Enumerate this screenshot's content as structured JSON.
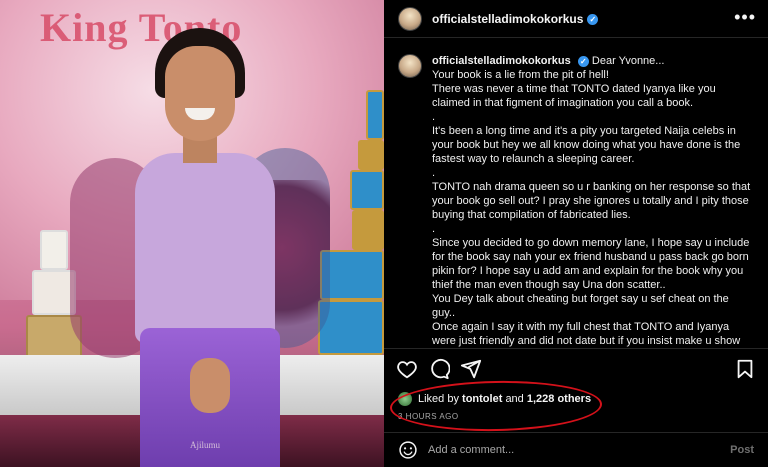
{
  "photo": {
    "banner_text": "King Tonto",
    "watermark": "Ajilumu"
  },
  "post": {
    "author": "officialstelladimokokorkus",
    "verified": true,
    "caption": {
      "author": "officialstelladimokokorkus",
      "verified_mark": "✓",
      "lines": [
        "Dear Yvonne...",
        "Your book is a lie from the pit of hell!",
        "There was never a time that TONTO dated Iyanya like you claimed in that figment of imagination you call a book.",
        ".",
        "It's been a long time and it's a pity you targeted Naija celebs in your book but hey we all know doing what you have done is the fastest way to relaunch a sleeping career.",
        ".",
        "TONTO nah drama queen so u r banking on her response so that your book go sell out? I pray she ignores u totally and I pity those buying that compilation of fabricated lies.",
        ".",
        "Since you decided to go down memory lane, I hope say u include for the book say nah your ex friend husband u pass back go born pikin for? I hope say u add am and explain for the book why you thief the man even though say Una don scatter..",
        "You Dey talk about cheating but forget say u sef cheat on the guy..",
        "Once again I say it with my full chest that TONTO and Iyanya were just friendly and did not date but if you insist make u show"
      ]
    },
    "likes": {
      "prefix": "Liked by",
      "user": "tontolet",
      "middle": "and",
      "count_text": "1,228 others"
    },
    "time_ago": "3 HOURS AGO",
    "comment": {
      "placeholder": "Add a comment...",
      "post_label": "Post"
    },
    "icons": [
      "heart-icon",
      "comment-icon",
      "share-icon",
      "bookmark-icon",
      "emoji-icon",
      "more-icon"
    ],
    "colors": {
      "verified": "#3897f0",
      "highlight_circle": "#d4111a",
      "secondary_text": "#a8a8a8"
    }
  }
}
